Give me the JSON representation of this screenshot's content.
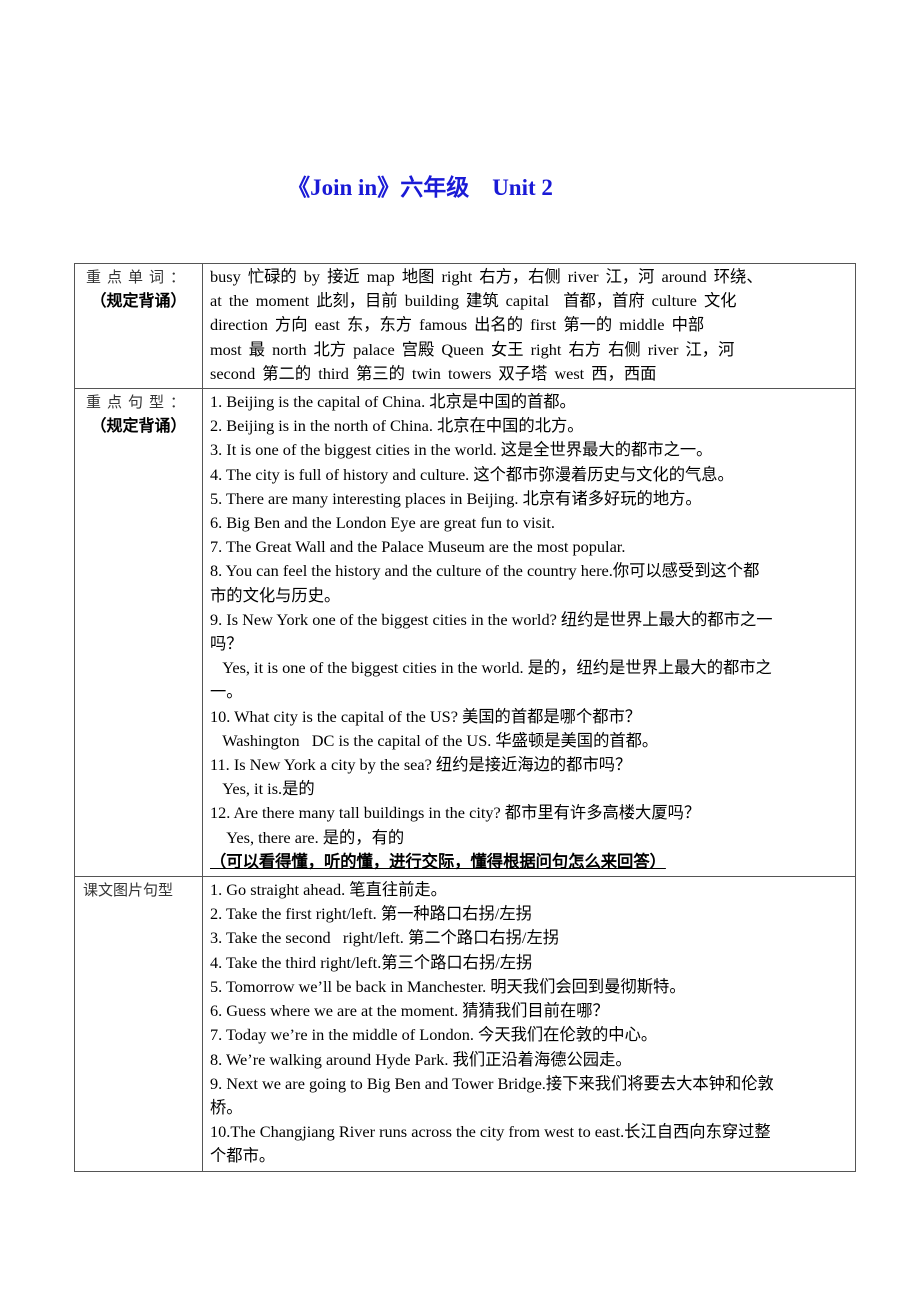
{
  "document": {
    "title": "《Join in》六年级    Unit 2"
  },
  "sections": [
    {
      "label_line1": "重点单词：",
      "label_line2": "（规定背诵）",
      "lines": [
        "busy 忙碌的 by 接近 map 地图 right 右方，右侧 river 江，河 around 环绕、",
        "at the moment 此刻，目前 building 建筑 capital  首都，首府 culture 文化",
        "direction 方向 east 东，东方 famous 出名的 first 第一的 middle 中部",
        "most 最 north 北方 palace 宫殿 Queen 女王 right 右方 右侧 river 江，河",
        "second 第二的 third 第三的 twin towers 双子塔 west 西，西面"
      ]
    },
    {
      "label_line1": "重点句型：",
      "label_line2": "（规定背诵）",
      "lines": [
        "1. Beijing is the capital of China. 北京是中国的首都。",
        "2. Beijing is in the north of China. 北京在中国的北方。",
        "3. It is one of the biggest cities in the world. 这是全世界最大的都市之一。",
        "4. The city is full of history and culture. 这个都市弥漫着历史与文化的气息。",
        "5. There are many interesting places in Beijing. 北京有诸多好玩的地方。",
        "6. Big Ben and the London Eye are great fun to visit.",
        "7. The Great Wall and the Palace Museum are the most popular.",
        "8. You can feel the history and the culture of the country here.你可以感受到这个都",
        "市的文化与历史。",
        "9. Is New York one of the biggest cities in the world? 纽约是世界上最大的都市之一",
        "吗？",
        "   Yes, it is one of the biggest cities in the world. 是的，纽约是世界上最大的都市之",
        "一。",
        "10. What city is the capital of the US? 美国的首都是哪个都市？",
        "   Washington   DC is the capital of the US. 华盛顿是美国的首都。",
        "11. Is New York a city by the sea? 纽约是接近海边的都市吗？",
        "   Yes, it is.是的",
        "12. Are there many tall buildings in the city? 都市里有许多高楼大厦吗？",
        "    Yes, there are. 是的，有的"
      ],
      "note": "（可以看得懂，听的懂，进行交际，懂得根据问句怎么来回答）"
    },
    {
      "label_line1": "课文图片句型",
      "lines": [
        "1. Go straight ahead. 笔直往前走。",
        "2. Take the first right/left. 第一种路口右拐/左拐",
        "3. Take the second   right/left. 第二个路口右拐/左拐",
        "4. Take the third right/left.第三个路口右拐/左拐",
        "5. Tomorrow we’ll be back in Manchester. 明天我们会回到曼彻斯特。",
        "6. Guess where we are at the moment. 猜猜我们目前在哪？",
        "7. Today we’re in the middle of London. 今天我们在伦敦的中心。",
        "8. We’re walking around Hyde Park. 我们正沿着海德公园走。",
        "9. Next we are going to Big Ben and Tower Bridge.接下来我们将要去大本钟和伦敦",
        "桥。",
        "10.The Changjiang River runs across the city from west to east.长江自西向东穿过整",
        "个都市。"
      ]
    }
  ]
}
